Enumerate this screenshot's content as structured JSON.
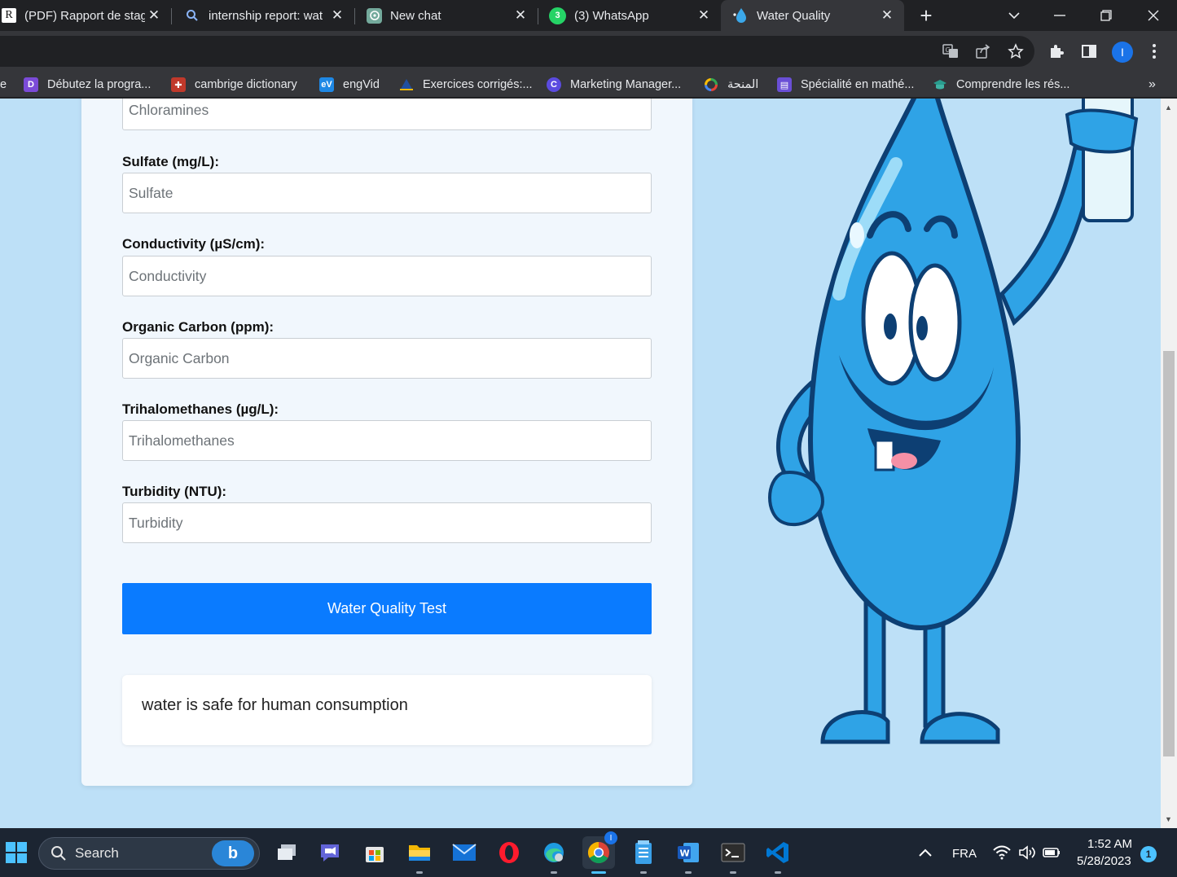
{
  "browser": {
    "tabs": [
      {
        "title": "(PDF) Rapport de stag",
        "icon": "researchgate-icon",
        "active": false
      },
      {
        "title": "internship report: wat",
        "icon": "search-icon",
        "active": false
      },
      {
        "title": "New chat",
        "icon": "chatgpt-icon",
        "active": false
      },
      {
        "title": "(3) WhatsApp",
        "icon": "whatsapp-icon",
        "active": false
      },
      {
        "title": "Water Quality",
        "icon": "water-drop-icon",
        "active": true
      }
    ],
    "profile_initial": "I",
    "bookmarks": [
      {
        "label": "e"
      },
      {
        "label": "Débutez la progra..."
      },
      {
        "label": "cambrige dictionary"
      },
      {
        "label": "engVid"
      },
      {
        "label": "Exercices corrigés:..."
      },
      {
        "label": "Marketing Manager..."
      },
      {
        "label": "المنحة"
      },
      {
        "label": "Spécialité en mathé..."
      },
      {
        "label": "Comprendre les rés..."
      }
    ],
    "bookmarks_overflow": "»"
  },
  "form": {
    "top_field": {
      "placeholder": "Chloramines"
    },
    "fields": [
      {
        "label": "Sulfate (mg/L):",
        "placeholder": "Sulfate"
      },
      {
        "label": "Conductivity (µS/cm):",
        "placeholder": "Conductivity"
      },
      {
        "label": "Organic Carbon (ppm):",
        "placeholder": "Organic Carbon"
      },
      {
        "label": "Trihalomethanes (µg/L):",
        "placeholder": "Trihalomethanes"
      },
      {
        "label": "Turbidity (NTU):",
        "placeholder": "Turbidity"
      }
    ],
    "submit_label": "Water Quality Test",
    "result_text": "water is safe for human consumption"
  },
  "colors": {
    "page_bg": "#bde0f7",
    "button": "#0a7bff",
    "drop": "#2fa3e6",
    "drop_outline": "#0d3f73"
  },
  "taskbar": {
    "search_placeholder": "Search",
    "language": "FRA",
    "time": "1:52 AM",
    "date": "5/28/2023",
    "notification_count": "1"
  }
}
